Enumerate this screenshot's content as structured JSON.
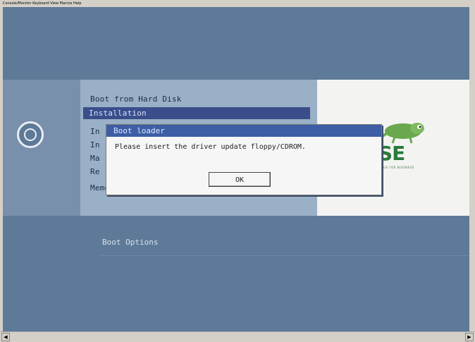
{
  "window": {
    "menubar_text": "Console/Monitor  Keyboard  View  Macros  Help"
  },
  "boot_menu": {
    "items": [
      {
        "label": "Boot from Hard Disk"
      },
      {
        "label": "Installation"
      },
      {
        "label": "In"
      },
      {
        "label": "In"
      },
      {
        "label": "Ma"
      },
      {
        "label": "Re"
      },
      {
        "label": "Memory Test"
      }
    ],
    "selected_index": 1
  },
  "dialog": {
    "title": "Boot loader",
    "message": "Please insert the driver update floppy/CDROM.",
    "ok_label": "OK"
  },
  "boot_options": {
    "label": "Boot Options"
  },
  "brand": {
    "word": "uSE",
    "tagline": "LINUX FOR BUSINESS",
    "logo": "suse-chameleon-icon"
  },
  "colors": {
    "background": "#5d7a98",
    "selection": "#3b4e8b",
    "dialog_title": "#3d5ea5",
    "brand_green": "#2a7a3c"
  }
}
